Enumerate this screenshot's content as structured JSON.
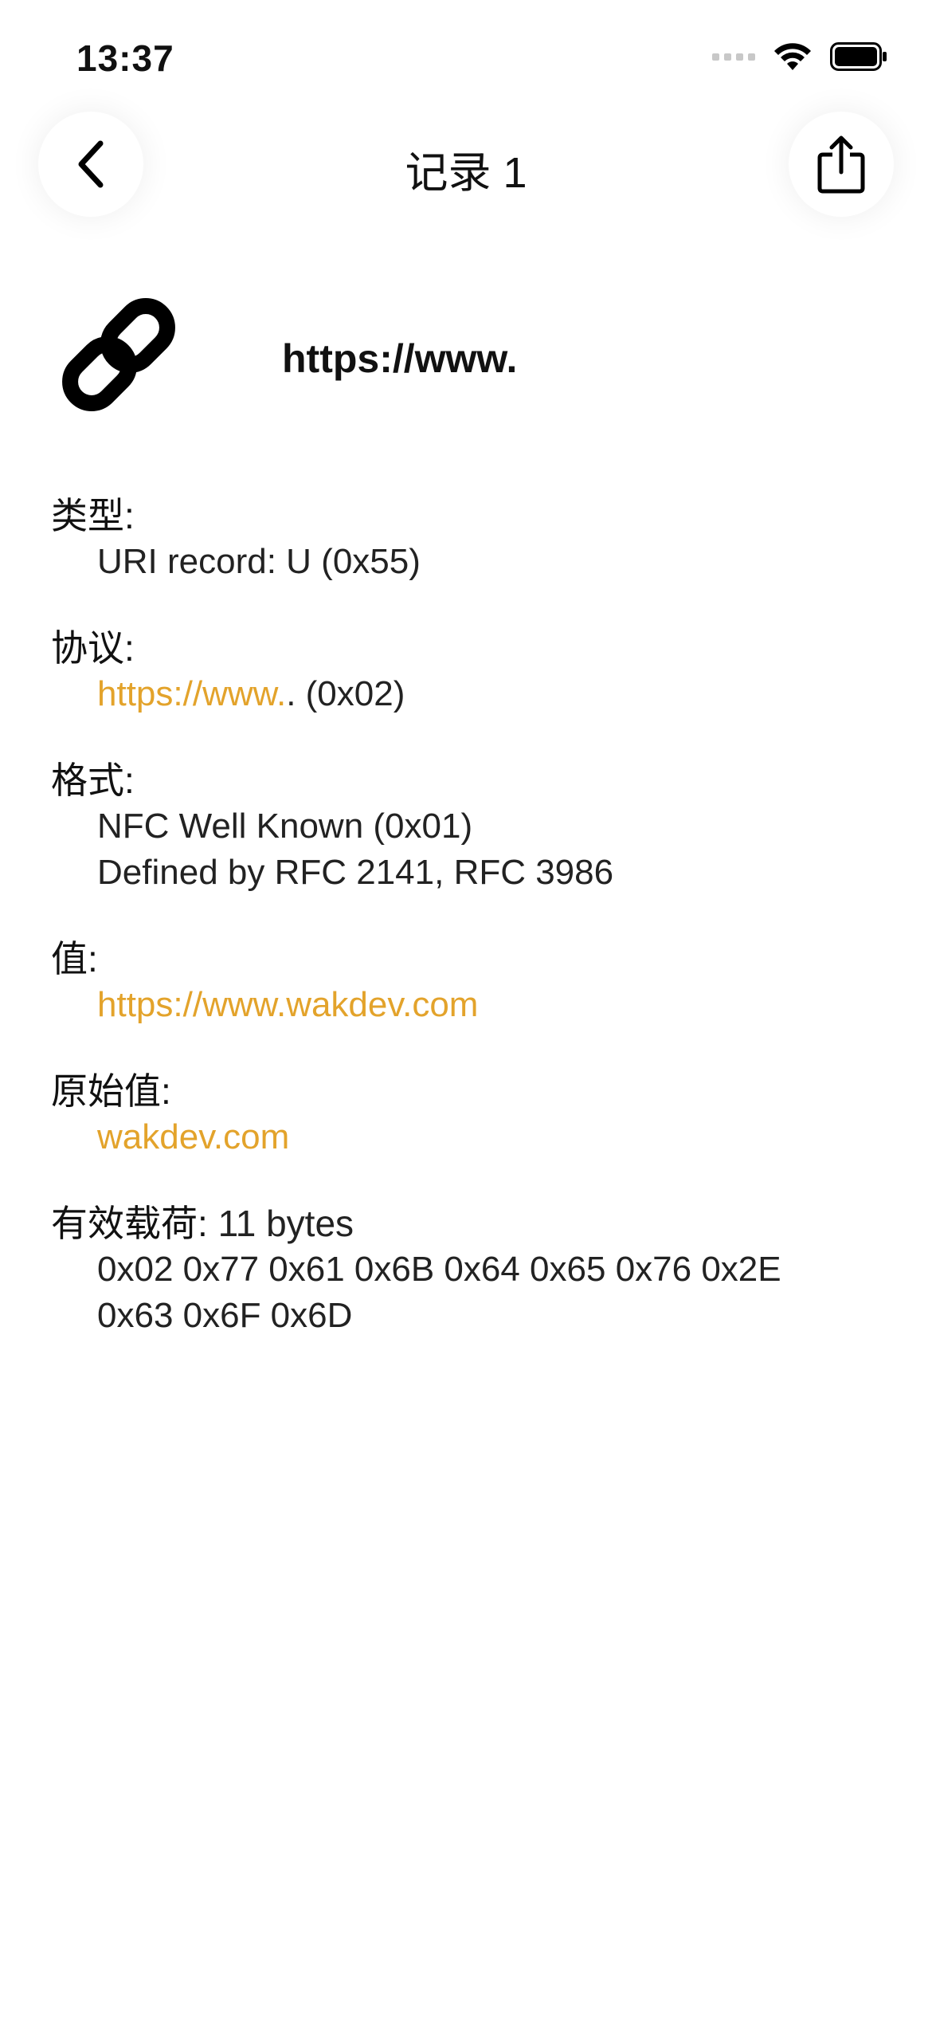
{
  "status_bar": {
    "time": "13:37"
  },
  "nav": {
    "title": "记录 1",
    "back_icon": "chevron-left-icon",
    "share_icon": "share-icon"
  },
  "record": {
    "icon": "link-icon",
    "title": "https://www."
  },
  "details": {
    "type": {
      "label": "类型:",
      "value": "URI record: U (0x55)"
    },
    "protocol": {
      "label": "协议:",
      "link": "https://www.",
      "suffix": ". (0x02)"
    },
    "format": {
      "label": "格式:",
      "line1": "NFC Well Known (0x01)",
      "line2": "Defined by RFC 2141, RFC 3986"
    },
    "value": {
      "label": "值:",
      "link": "https://www.wakdev.com"
    },
    "raw_value": {
      "label": "原始值:",
      "link": "wakdev.com"
    },
    "payload": {
      "label": "有效载荷:",
      "size": "11 bytes",
      "line1": "0x02 0x77 0x61 0x6B 0x64 0x65 0x76 0x2E",
      "line2": "0x63 0x6F 0x6D"
    }
  },
  "colors": {
    "accent": "#e3a32b",
    "text": "#111111",
    "background": "#ffffff"
  }
}
